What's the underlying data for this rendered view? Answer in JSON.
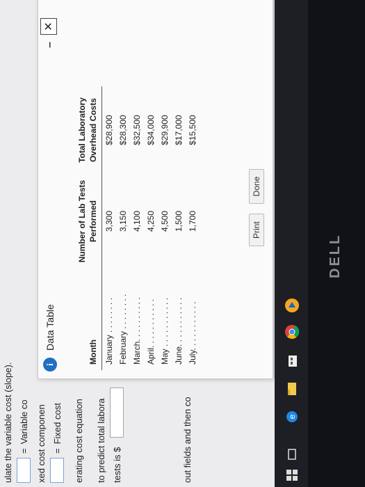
{
  "background": {
    "instruction": "ulate the variable cost (slope).",
    "variable_cost_label": "Variable co",
    "variable_cost_eq": "=",
    "fixed_component_label": "xed cost componen",
    "fixed_cost_label": "Fixed cost",
    "fixed_cost_eq": "=",
    "operating_equation_label": "erating cost equation",
    "predict_label": "to predict total labora",
    "tests_label": "tests is $",
    "input_fields_hint": "out fields and then co"
  },
  "dialog": {
    "title": "Data Table",
    "minimize": "–",
    "close": "✕",
    "table": {
      "headers": {
        "month": "Month",
        "tests": "Number of Lab Tests Performed",
        "cost": "Total Laboratory Overhead Costs"
      },
      "rows": [
        {
          "month": "January . . . . . . . .",
          "tests": "3,300",
          "cost": "$28,900"
        },
        {
          "month": "February . . . . . . . .",
          "tests": "3,150",
          "cost": "$28,300"
        },
        {
          "month": "March. . . . . . . . . .",
          "tests": "4,100",
          "cost": "$32,500"
        },
        {
          "month": "April. . . . . . . . . . .",
          "tests": "4,250",
          "cost": "$34,000"
        },
        {
          "month": "May . . . . . . . . . . .",
          "tests": "4,500",
          "cost": "$29,900"
        },
        {
          "month": "June. . . . . . . . . . .",
          "tests": "1,500",
          "cost": "$17,000"
        },
        {
          "month": "July. . . . . . . . . . .",
          "tests": "1,700",
          "cost": "$15,500"
        }
      ]
    },
    "print_label": "Print",
    "done_label": "Done"
  },
  "taskbar": {
    "icons": [
      "start-icon",
      "task-view-icon",
      "edge-icon",
      "file-explorer-icon",
      "store-icon",
      "chrome-icon",
      "media-icon"
    ]
  },
  "bezel": {
    "logo_text": "DELL"
  }
}
